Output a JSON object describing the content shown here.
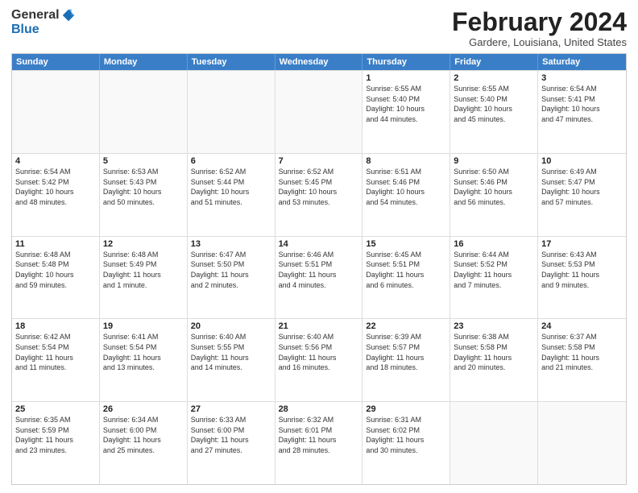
{
  "logo": {
    "general": "General",
    "blue": "Blue"
  },
  "title": "February 2024",
  "location": "Gardere, Louisiana, United States",
  "header_days": [
    "Sunday",
    "Monday",
    "Tuesday",
    "Wednesday",
    "Thursday",
    "Friday",
    "Saturday"
  ],
  "weeks": [
    [
      {
        "day": "",
        "info": ""
      },
      {
        "day": "",
        "info": ""
      },
      {
        "day": "",
        "info": ""
      },
      {
        "day": "",
        "info": ""
      },
      {
        "day": "1",
        "info": "Sunrise: 6:55 AM\nSunset: 5:40 PM\nDaylight: 10 hours\nand 44 minutes."
      },
      {
        "day": "2",
        "info": "Sunrise: 6:55 AM\nSunset: 5:40 PM\nDaylight: 10 hours\nand 45 minutes."
      },
      {
        "day": "3",
        "info": "Sunrise: 6:54 AM\nSunset: 5:41 PM\nDaylight: 10 hours\nand 47 minutes."
      }
    ],
    [
      {
        "day": "4",
        "info": "Sunrise: 6:54 AM\nSunset: 5:42 PM\nDaylight: 10 hours\nand 48 minutes."
      },
      {
        "day": "5",
        "info": "Sunrise: 6:53 AM\nSunset: 5:43 PM\nDaylight: 10 hours\nand 50 minutes."
      },
      {
        "day": "6",
        "info": "Sunrise: 6:52 AM\nSunset: 5:44 PM\nDaylight: 10 hours\nand 51 minutes."
      },
      {
        "day": "7",
        "info": "Sunrise: 6:52 AM\nSunset: 5:45 PM\nDaylight: 10 hours\nand 53 minutes."
      },
      {
        "day": "8",
        "info": "Sunrise: 6:51 AM\nSunset: 5:46 PM\nDaylight: 10 hours\nand 54 minutes."
      },
      {
        "day": "9",
        "info": "Sunrise: 6:50 AM\nSunset: 5:46 PM\nDaylight: 10 hours\nand 56 minutes."
      },
      {
        "day": "10",
        "info": "Sunrise: 6:49 AM\nSunset: 5:47 PM\nDaylight: 10 hours\nand 57 minutes."
      }
    ],
    [
      {
        "day": "11",
        "info": "Sunrise: 6:48 AM\nSunset: 5:48 PM\nDaylight: 10 hours\nand 59 minutes."
      },
      {
        "day": "12",
        "info": "Sunrise: 6:48 AM\nSunset: 5:49 PM\nDaylight: 11 hours\nand 1 minute."
      },
      {
        "day": "13",
        "info": "Sunrise: 6:47 AM\nSunset: 5:50 PM\nDaylight: 11 hours\nand 2 minutes."
      },
      {
        "day": "14",
        "info": "Sunrise: 6:46 AM\nSunset: 5:51 PM\nDaylight: 11 hours\nand 4 minutes."
      },
      {
        "day": "15",
        "info": "Sunrise: 6:45 AM\nSunset: 5:51 PM\nDaylight: 11 hours\nand 6 minutes."
      },
      {
        "day": "16",
        "info": "Sunrise: 6:44 AM\nSunset: 5:52 PM\nDaylight: 11 hours\nand 7 minutes."
      },
      {
        "day": "17",
        "info": "Sunrise: 6:43 AM\nSunset: 5:53 PM\nDaylight: 11 hours\nand 9 minutes."
      }
    ],
    [
      {
        "day": "18",
        "info": "Sunrise: 6:42 AM\nSunset: 5:54 PM\nDaylight: 11 hours\nand 11 minutes."
      },
      {
        "day": "19",
        "info": "Sunrise: 6:41 AM\nSunset: 5:54 PM\nDaylight: 11 hours\nand 13 minutes."
      },
      {
        "day": "20",
        "info": "Sunrise: 6:40 AM\nSunset: 5:55 PM\nDaylight: 11 hours\nand 14 minutes."
      },
      {
        "day": "21",
        "info": "Sunrise: 6:40 AM\nSunset: 5:56 PM\nDaylight: 11 hours\nand 16 minutes."
      },
      {
        "day": "22",
        "info": "Sunrise: 6:39 AM\nSunset: 5:57 PM\nDaylight: 11 hours\nand 18 minutes."
      },
      {
        "day": "23",
        "info": "Sunrise: 6:38 AM\nSunset: 5:58 PM\nDaylight: 11 hours\nand 20 minutes."
      },
      {
        "day": "24",
        "info": "Sunrise: 6:37 AM\nSunset: 5:58 PM\nDaylight: 11 hours\nand 21 minutes."
      }
    ],
    [
      {
        "day": "25",
        "info": "Sunrise: 6:35 AM\nSunset: 5:59 PM\nDaylight: 11 hours\nand 23 minutes."
      },
      {
        "day": "26",
        "info": "Sunrise: 6:34 AM\nSunset: 6:00 PM\nDaylight: 11 hours\nand 25 minutes."
      },
      {
        "day": "27",
        "info": "Sunrise: 6:33 AM\nSunset: 6:00 PM\nDaylight: 11 hours\nand 27 minutes."
      },
      {
        "day": "28",
        "info": "Sunrise: 6:32 AM\nSunset: 6:01 PM\nDaylight: 11 hours\nand 28 minutes."
      },
      {
        "day": "29",
        "info": "Sunrise: 6:31 AM\nSunset: 6:02 PM\nDaylight: 11 hours\nand 30 minutes."
      },
      {
        "day": "",
        "info": ""
      },
      {
        "day": "",
        "info": ""
      }
    ]
  ]
}
